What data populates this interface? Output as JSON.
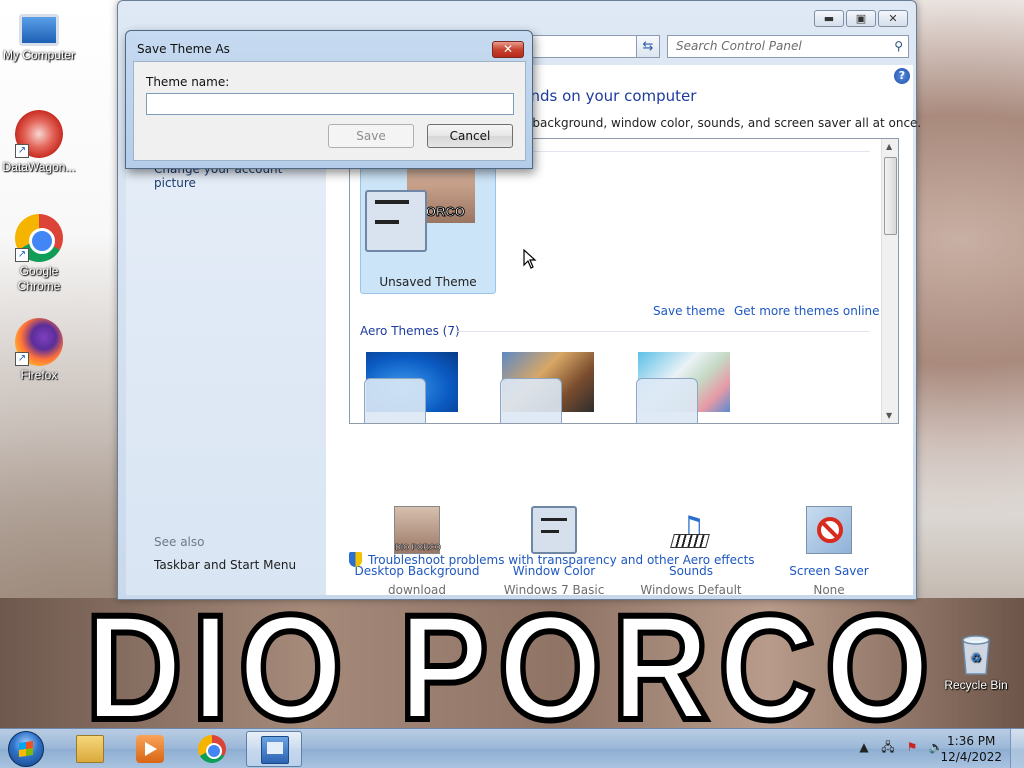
{
  "desktop": {
    "icons": [
      {
        "label": "My Computer"
      },
      {
        "label": "DataWagon..."
      },
      {
        "label": "Google Chrome"
      },
      {
        "label": "Firefox"
      }
    ],
    "recycle_bin": {
      "label": "Recycle Bin"
    },
    "wallpaper_text": "DIO PORCO"
  },
  "control_panel": {
    "search_placeholder": "Search Control Panel",
    "heading_fragment": "unds on your computer",
    "subheading_fragment": "p background, window color, sounds, and screen saver all at once.",
    "left_links": {
      "account_picture": "Change your account picture",
      "see_also": "See also",
      "taskbar": "Taskbar and Start Menu"
    },
    "my_themes": {
      "unsaved_theme_label": "Unsaved Theme",
      "unsaved_theme_caption": "PORCO",
      "save_theme": "Save theme",
      "get_more": "Get more themes online"
    },
    "aero_themes_header": "Aero Themes (7)",
    "settings": [
      {
        "title": "Desktop Background",
        "value": "download",
        "icon": "desktop-background-icon",
        "caption": "DIO PORCO"
      },
      {
        "title": "Window Color",
        "value": "Windows 7 Basic",
        "icon": "window-color-icon"
      },
      {
        "title": "Sounds",
        "value": "Windows Default",
        "icon": "sounds-icon"
      },
      {
        "title": "Screen Saver",
        "value": "None",
        "icon": "screen-saver-icon"
      }
    ],
    "troubleshoot": "Troubleshoot problems with transparency and other Aero effects"
  },
  "dialog": {
    "title": "Save Theme As",
    "theme_name_label": "Theme name:",
    "theme_name_value": "",
    "save_label": "Save",
    "cancel_label": "Cancel",
    "close_glyph": "✕"
  },
  "taskbar": {
    "clock_time": "1:36 PM",
    "clock_date": "12/4/2022"
  }
}
